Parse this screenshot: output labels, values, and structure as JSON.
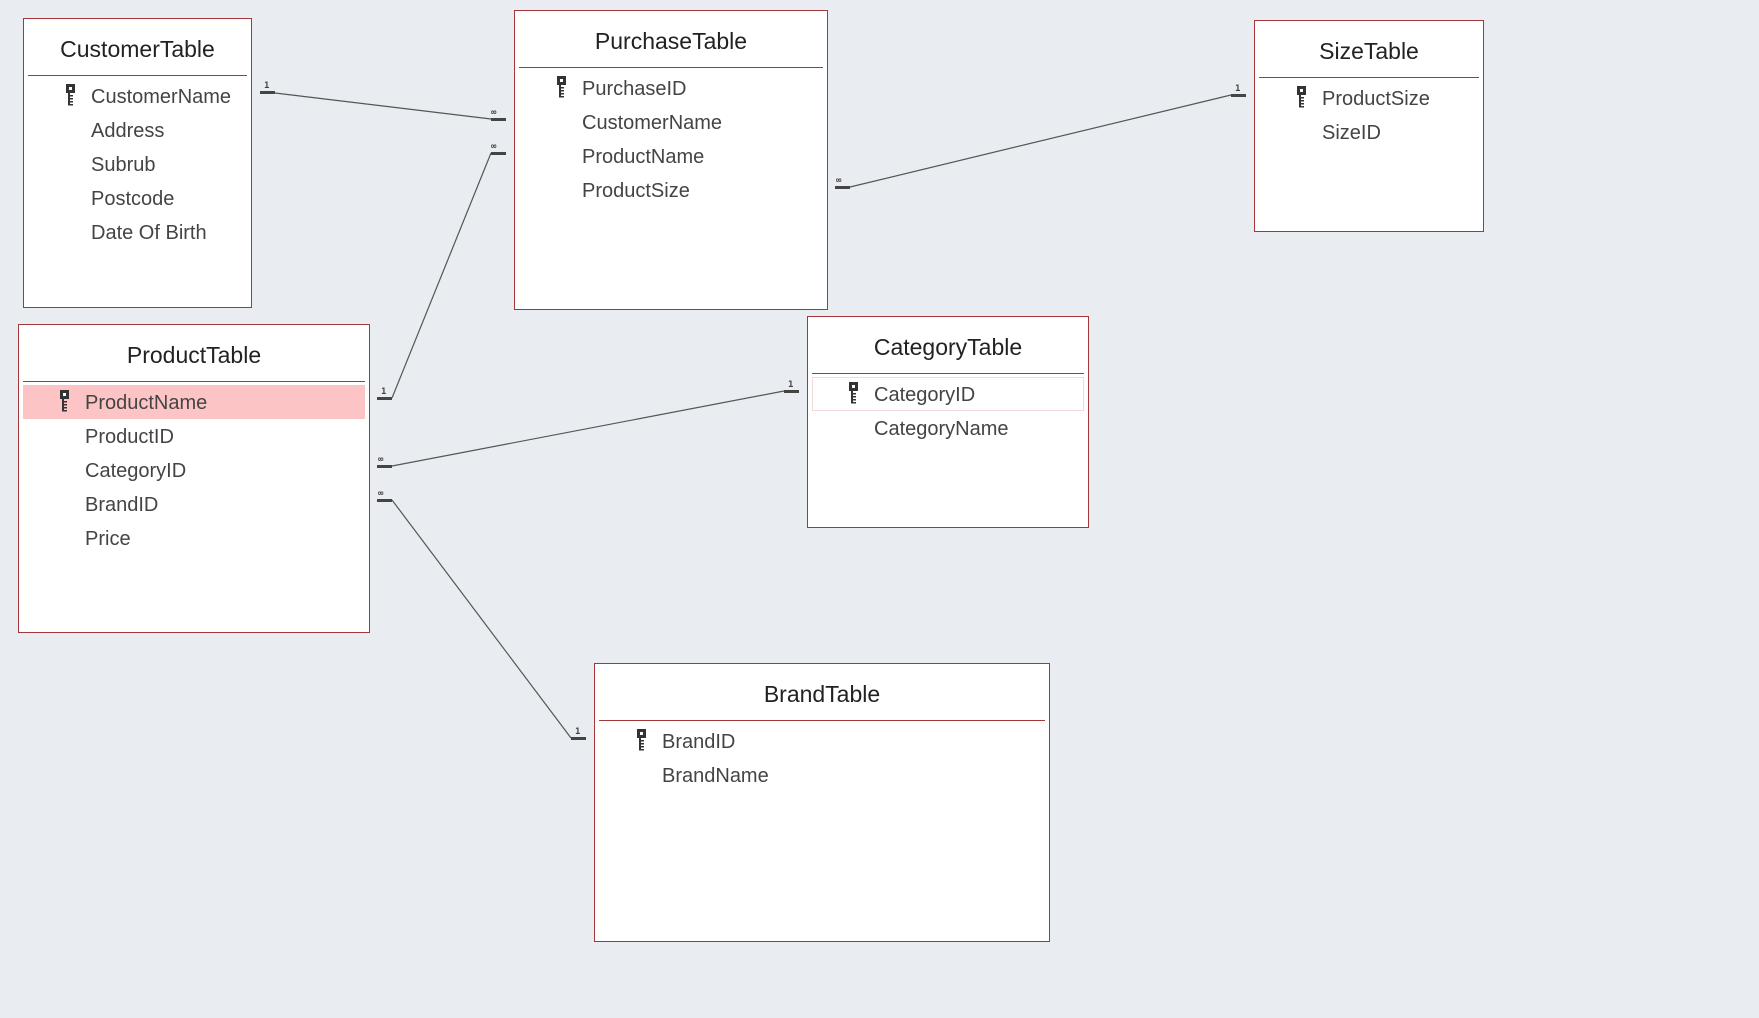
{
  "diagram": {
    "colors": {
      "background": "#e9edf1",
      "table_border": "#a4373a",
      "selected_row": "#fcc4c4",
      "line": "#555555"
    },
    "tables": [
      {
        "id": "customer",
        "title": "CustomerTable",
        "fields": [
          {
            "name": "CustomerName",
            "primary_key": true
          },
          {
            "name": "Address",
            "primary_key": false
          },
          {
            "name": "Subrub",
            "primary_key": false
          },
          {
            "name": "Postcode",
            "primary_key": false
          },
          {
            "name": "Date Of Birth",
            "primary_key": false
          }
        ]
      },
      {
        "id": "purchase",
        "title": "PurchaseTable",
        "fields": [
          {
            "name": "PurchaseID",
            "primary_key": true
          },
          {
            "name": "CustomerName",
            "primary_key": false
          },
          {
            "name": "ProductName",
            "primary_key": false
          },
          {
            "name": "ProductSize",
            "primary_key": false
          }
        ]
      },
      {
        "id": "size",
        "title": "SizeTable",
        "fields": [
          {
            "name": "ProductSize",
            "primary_key": true
          },
          {
            "name": "SizeID",
            "primary_key": false
          }
        ]
      },
      {
        "id": "product",
        "title": "ProductTable",
        "fields": [
          {
            "name": "ProductName",
            "primary_key": true,
            "selected": true
          },
          {
            "name": "ProductID",
            "primary_key": false
          },
          {
            "name": "CategoryID",
            "primary_key": false
          },
          {
            "name": "BrandID",
            "primary_key": false
          },
          {
            "name": "Price",
            "primary_key": false
          }
        ]
      },
      {
        "id": "category",
        "title": "CategoryTable",
        "fields": [
          {
            "name": "CategoryID",
            "primary_key": true,
            "focused": true
          },
          {
            "name": "CategoryName",
            "primary_key": false
          }
        ]
      },
      {
        "id": "brand",
        "title": "BrandTable",
        "fields": [
          {
            "name": "BrandID",
            "primary_key": true
          },
          {
            "name": "BrandName",
            "primary_key": false
          }
        ]
      }
    ],
    "relationships": [
      {
        "from": "CustomerTable.CustomerName",
        "to": "PurchaseTable.CustomerName",
        "from_label": "1",
        "to_label": "∞"
      },
      {
        "from": "ProductTable.ProductName",
        "to": "PurchaseTable.ProductName",
        "from_label": "1",
        "to_label": "∞"
      },
      {
        "from": "SizeTable.ProductSize",
        "to": "PurchaseTable.ProductSize",
        "from_label": "1",
        "to_label": "∞"
      },
      {
        "from": "CategoryTable.CategoryID",
        "to": "ProductTable.CategoryID",
        "from_label": "1",
        "to_label": "∞"
      },
      {
        "from": "BrandTable.BrandID",
        "to": "ProductTable.BrandID",
        "from_label": "1",
        "to_label": "∞"
      }
    ]
  }
}
